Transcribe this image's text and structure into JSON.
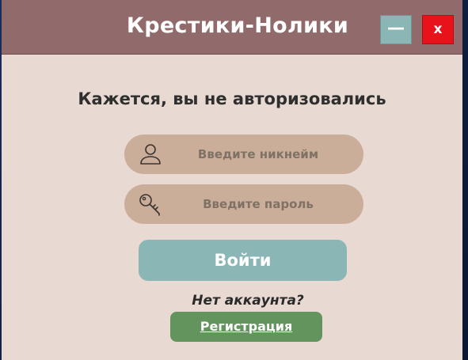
{
  "window": {
    "title": "Крестики-Нолики",
    "minimize_label": "—",
    "close_label": "x"
  },
  "auth": {
    "heading": "Кажется, вы не авторизовались",
    "nickname_placeholder": "Введите никнейм",
    "password_placeholder": "Введите пароль",
    "login_label": "Войти",
    "no_account_text": "Нет аккаунта?",
    "register_label": "Регистрация"
  },
  "icons": {
    "nickname": "user-icon",
    "password": "key-icon"
  },
  "colors": {
    "titlebar": "#916b6b",
    "background": "#e8dad2",
    "field": "#cbae9a",
    "login_button": "#8bb6b6",
    "register_button": "#63945e",
    "close_button": "#e8121b"
  }
}
